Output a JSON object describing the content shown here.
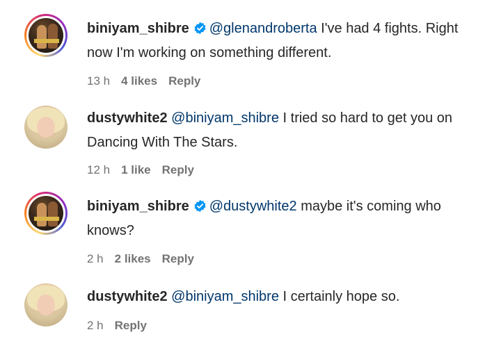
{
  "comments": [
    {
      "username": "biniyam_shibre",
      "verified": true,
      "mention": "@glenandroberta",
      "text": " I've had 4 fights. Right now I'm working on something different.",
      "time": "13 h",
      "likes": "4 likes",
      "reply": "Reply",
      "avatar": "boxer-photo"
    },
    {
      "username": "dustywhite2",
      "verified": false,
      "mention": "@biniyam_shibre",
      "text": " I tried so hard to get you on Dancing With The Stars.",
      "time": "12 h",
      "likes": "1 like",
      "reply": "Reply",
      "avatar": "blonde-woman-photo"
    },
    {
      "username": "biniyam_shibre",
      "verified": true,
      "mention": "@dustywhite2",
      "text": " maybe it's coming who knows?",
      "time": "2 h",
      "likes": "2 likes",
      "reply": "Reply",
      "avatar": "boxer-photo"
    },
    {
      "username": "dustywhite2",
      "verified": false,
      "mention": "@biniyam_shibre",
      "text": " I certainly hope so.",
      "time": "2 h",
      "likes": "",
      "reply": "Reply",
      "avatar": "blonde-woman-photo"
    }
  ],
  "colors": {
    "text": "#262626",
    "mention": "#00376b",
    "meta": "#737373",
    "verified": "#0095f6"
  }
}
